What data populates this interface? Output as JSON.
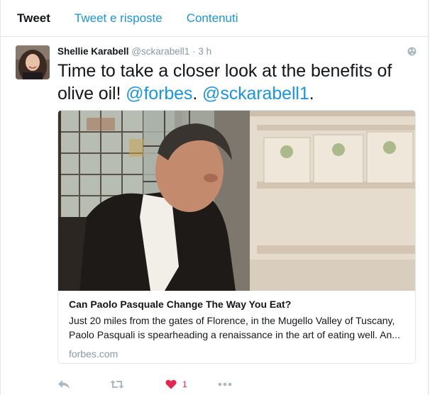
{
  "tabs": [
    {
      "label": "Tweet"
    },
    {
      "label": "Tweet e risposte"
    },
    {
      "label": "Contenuti"
    }
  ],
  "tweet": {
    "author_name": "Shellie Karabell",
    "author_handle": "@sckarabell1",
    "separator": "·",
    "time": "3 h",
    "text_part1": "Time to take a closer look at the benefits of olive oil! ",
    "mention1": "@forbes",
    "text_part2": ". ",
    "mention2": "@sckarabell1",
    "text_part3": ".",
    "link_card": {
      "title": "Can Paolo Pasquale Change The Way You Eat?",
      "description": "Just 20 miles from the gates of Florence, in the Mugello Valley of Tuscany, Paolo Pasquali is spearheading a renaissance in the art of eating well. An...",
      "domain": "forbes.com"
    },
    "actions": {
      "reply_icon": "reply-icon",
      "retweet_icon": "retweet-icon",
      "like_icon": "heart-icon",
      "like_count": "1",
      "more_icon": "more-icon",
      "like_color": "#e2264d"
    }
  },
  "colors": {
    "accent": "#1b95e0",
    "muted": "#8899a6",
    "border": "#e1e8ed"
  }
}
